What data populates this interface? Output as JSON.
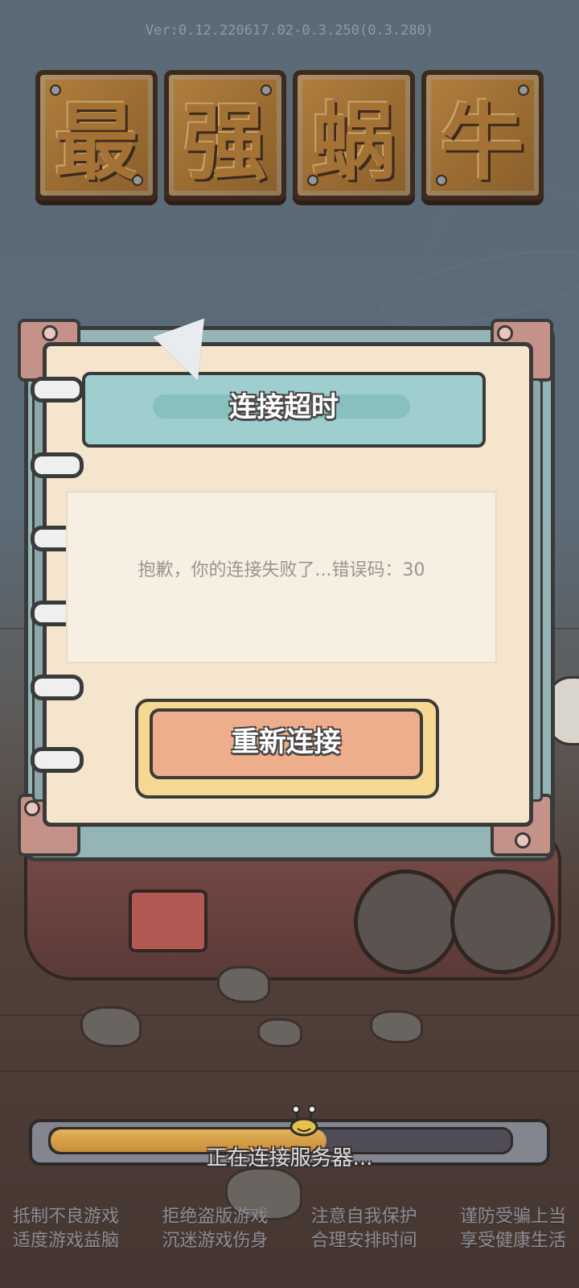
{
  "version": "Ver:0.12.220617.02-0.3.250(0.3.280)",
  "logo": {
    "characters": [
      "最",
      "强",
      "蜗",
      "牛"
    ]
  },
  "dialog": {
    "title": "连接超时",
    "message": "抱歉，你的连接失败了...错误码：30",
    "retry_label": "重新连接"
  },
  "loading": {
    "status": "正在连接服务器...",
    "progress": 0.6
  },
  "health_notice": {
    "line1": [
      "抵制不良游戏",
      "拒绝盗版游戏",
      "注意自我保护",
      "谨防受骗上当"
    ],
    "line2": [
      "适度游戏益脑",
      "沉迷游戏伤身",
      "合理安排时间",
      "享受健康生活"
    ]
  },
  "colors": {
    "panel_teal": "#95b4b6",
    "paper": "#f4e5cc",
    "title_banner": "#9ecfce",
    "retry_button": "#eeae8c",
    "progress_fill": "#d9a24a"
  },
  "icons": [
    "spiral-ring-icon",
    "snail-icon",
    "pennant-icon"
  ]
}
